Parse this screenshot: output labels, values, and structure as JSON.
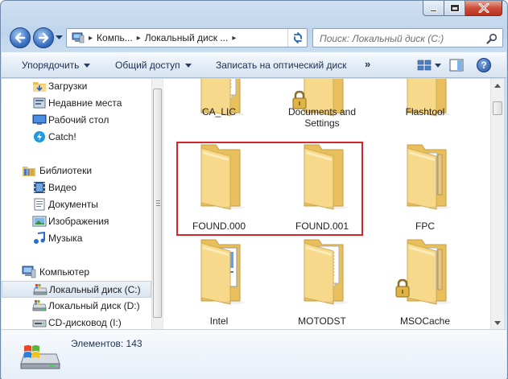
{
  "window": {
    "caption_buttons": [
      "minimize",
      "maximize",
      "close"
    ]
  },
  "address_bar": {
    "parts": [
      "Компь...",
      "Локальный диск ...",
      ""
    ],
    "root_icon": "computer-icon"
  },
  "search": {
    "placeholder": "Поиск: Локальный диск (C:)"
  },
  "toolbar": {
    "organize": "Упорядочить",
    "share": "Общий доступ",
    "burn": "Записать на оптический диск",
    "more": "»"
  },
  "nav": {
    "items": [
      {
        "label": "Загрузки",
        "icon": "downloads-folder-icon"
      },
      {
        "label": "Недавние места",
        "icon": "recent-places-icon"
      },
      {
        "label": "Рабочий стол",
        "icon": "desktop-icon"
      },
      {
        "label": "Catch!",
        "icon": "catch-icon"
      },
      {
        "label": "Библиотеки",
        "icon": "libraries-icon"
      },
      {
        "label": "Видео",
        "icon": "video-library-icon"
      },
      {
        "label": "Документы",
        "icon": "documents-library-icon"
      },
      {
        "label": "Изображения",
        "icon": "pictures-library-icon"
      },
      {
        "label": "Музыка",
        "icon": "music-library-icon"
      },
      {
        "label": "Компьютер",
        "icon": "computer-icon"
      },
      {
        "label": "Локальный диск (C:)",
        "icon": "local-disk-icon",
        "selected": true
      },
      {
        "label": "Локальный диск (D:)",
        "icon": "local-disk-icon"
      },
      {
        "label": "CD-дисковод (I:)",
        "icon": "cd-drive-icon"
      }
    ]
  },
  "files": {
    "items": [
      {
        "label": "CA_LIC",
        "type": "folder-with-docs",
        "locked": false
      },
      {
        "label": "Documents and Settings",
        "type": "folder-empty",
        "locked": true
      },
      {
        "label": "Flashtool",
        "type": "folder-empty",
        "locked": false
      },
      {
        "label": "FOUND.000",
        "type": "folder-empty",
        "locked": false,
        "highlighted": true
      },
      {
        "label": "FOUND.001",
        "type": "folder-empty",
        "locked": false,
        "highlighted": true
      },
      {
        "label": "FPC",
        "type": "folder-with-files",
        "locked": false
      },
      {
        "label": "Intel",
        "type": "folder-with-image",
        "locked": false
      },
      {
        "label": "MOTODST",
        "type": "folder-with-docs",
        "locked": false
      },
      {
        "label": "MSOCache",
        "type": "folder-with-files",
        "locked": true
      }
    ]
  },
  "status": {
    "count": "Элементов: 143"
  },
  "colors": {
    "highlight_border": "#d6252b",
    "folder_front": "#f6d98a",
    "folder_back": "#e7bf5c",
    "frame": "#c9dcef"
  }
}
